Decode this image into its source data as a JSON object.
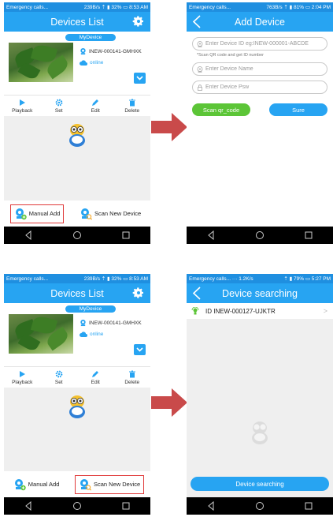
{
  "colors": {
    "primary": "#27a4f2",
    "status_bar": "#1f8fe0",
    "green": "#5cc537",
    "highlight": "#e03a3a",
    "arrow": "#c94a4a"
  },
  "panels": {
    "top_left": {
      "status": {
        "left": "Emergency calls...",
        "right": "239B/s ⇡ ▮ 32% ▭ 8:53 AM"
      },
      "title": "Devices List",
      "device": {
        "name": "MyDevice",
        "id": "INEW-000141-GMHXK",
        "status": "online"
      },
      "actions": [
        {
          "label": "Playback",
          "icon": "play-icon"
        },
        {
          "label": "Set",
          "icon": "gear-icon"
        },
        {
          "label": "Edit",
          "icon": "pencil-icon"
        },
        {
          "label": "Delete",
          "icon": "trash-icon"
        }
      ],
      "manual_add": "Manual Add",
      "scan_new": "Scan New Device"
    },
    "top_right": {
      "status": {
        "left": "Emergency calls...",
        "right": "763B/s ⇡ ▮ 81% ▭ 2:04 PM"
      },
      "title": "Add Device",
      "device_id_placeholder": "Enter Device ID eg:INEW-000001-ABCDE",
      "hint": "*Scan QR code and get ID number",
      "device_name_placeholder": "Enter Device Name",
      "device_psw_placeholder": "Enter Device Psw",
      "scan_btn": "Scan qr_code",
      "sure_btn": "Sure"
    },
    "bottom_left": {
      "status": {
        "left": "Emergency calls...",
        "right": "239B/s ⇡ ▮ 32% ▭ 8:53 AM"
      },
      "title": "Devices List",
      "device": {
        "name": "MyDevice",
        "id": "INEW-000141-GMHXK",
        "status": "online"
      },
      "actions": [
        {
          "label": "Playback",
          "icon": "play-icon"
        },
        {
          "label": "Set",
          "icon": "gear-icon"
        },
        {
          "label": "Edit",
          "icon": "pencil-icon"
        },
        {
          "label": "Delete",
          "icon": "trash-icon"
        }
      ],
      "manual_add": "Manual Add",
      "scan_new": "Scan New Device"
    },
    "bottom_right": {
      "status": {
        "left": "Emergency calls... ··· 1.2K/s",
        "right": "⇡ ▮ 79% ▭ 5:27 PM"
      },
      "title": "Device searching",
      "found_device": "ID INEW-000127-UJKTR",
      "search_btn": "Device searching"
    }
  }
}
